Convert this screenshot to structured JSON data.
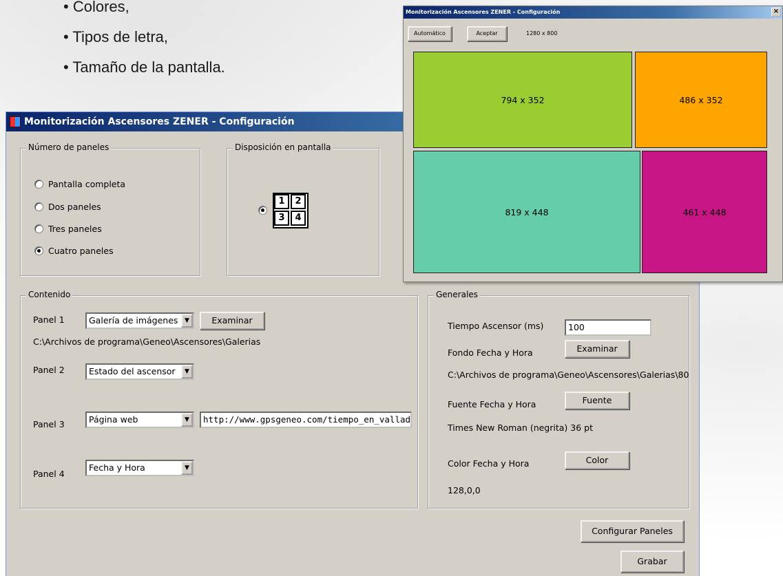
{
  "slide": {
    "bullets": [
      "Colores,",
      "Tipos de letra,",
      "Tamaño de la pantalla."
    ]
  },
  "config_window": {
    "title": "Monitorización Ascensores ZENER - Configuración",
    "num_paneles": {
      "title": "Número de paneles",
      "options": [
        "Pantalla completa",
        "Dos paneles",
        "Tres paneles",
        "Cuatro paneles"
      ],
      "selected": "Cuatro paneles"
    },
    "disposicion": {
      "title": "Disposición en pantalla",
      "grid_labels": [
        "1",
        "2",
        "3",
        "4"
      ]
    },
    "contenido": {
      "title": "Contenido",
      "panel1_label": "Panel 1",
      "panel1_value": "Galería de imágenes",
      "panel1_button": "Examinar",
      "panel1_path": "C:\\Archivos de programa\\Geneo\\Ascensores\\Galerias",
      "panel2_label": "Panel 2",
      "panel2_value": "Estado del ascensor",
      "panel3_label": "Panel 3",
      "panel3_value": "Página web",
      "panel3_url": "http://www.gpsgeneo.com/tiempo_en_valladol",
      "panel4_label": "Panel 4",
      "panel4_value": "Fecha y Hora"
    },
    "generales": {
      "title": "Generales",
      "tiempo_label": "Tiempo Ascensor (ms)",
      "tiempo_value": "100",
      "fondo_label": "Fondo Fecha y Hora",
      "fondo_button": "Examinar",
      "fondo_path": "C:\\Archivos de programa\\Geneo\\Ascensores\\Galerias\\80",
      "fuente_label": "Fuente Fecha y Hora",
      "fuente_button": "Fuente",
      "fuente_value": "Times New Roman (negrita) 36 pt",
      "color_label": "Color Fecha y Hora",
      "color_button": "Color",
      "color_value": "128,0,0"
    },
    "buttons": {
      "configurar": "Configurar Paneles",
      "grabar": "Grabar"
    }
  },
  "preview_window": {
    "title": "Monitorización Ascensores ZENER - Configuración",
    "close": "×",
    "auto_button": "Automático",
    "accept_button": "Aceptar",
    "resolution": "1280 x 800",
    "panels": [
      {
        "label": "794 x 352",
        "color": "#9acd32"
      },
      {
        "label": "486 x 352",
        "color": "#ffa500"
      },
      {
        "label": "819 x 448",
        "color": "#66cdaa"
      },
      {
        "label": "461 x 448",
        "color": "#c71585"
      }
    ]
  }
}
